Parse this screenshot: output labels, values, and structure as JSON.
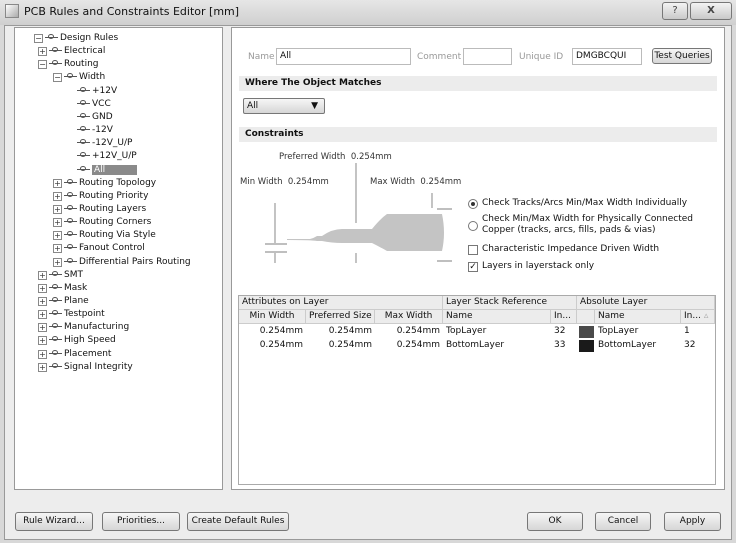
{
  "window": {
    "title": "PCB Rules and Constraints Editor [mm]",
    "help_label": "?",
    "close_label": "X"
  },
  "tree": {
    "items": [
      {
        "label": "Design Rules",
        "level": 0,
        "exp": "−"
      },
      {
        "label": "Electrical",
        "level": 1,
        "exp": "+"
      },
      {
        "label": "Routing",
        "level": 1,
        "exp": "−"
      },
      {
        "label": "Width",
        "level": 2,
        "exp": "−"
      },
      {
        "label": "+12V",
        "level": 3
      },
      {
        "label": "VCC",
        "level": 3
      },
      {
        "label": "GND",
        "level": 3
      },
      {
        "label": "-12V",
        "level": 3
      },
      {
        "label": "-12V_U/P",
        "level": 3
      },
      {
        "label": "+12V_U/P",
        "level": 3
      },
      {
        "label": "All",
        "level": 3,
        "selected": true
      },
      {
        "label": "Routing Topology",
        "level": 2,
        "exp": "+"
      },
      {
        "label": "Routing Priority",
        "level": 2,
        "exp": "+"
      },
      {
        "label": "Routing Layers",
        "level": 2,
        "exp": "+"
      },
      {
        "label": "Routing Corners",
        "level": 2,
        "exp": "+"
      },
      {
        "label": "Routing Via Style",
        "level": 2,
        "exp": "+"
      },
      {
        "label": "Fanout Control",
        "level": 2,
        "exp": "+"
      },
      {
        "label": "Differential Pairs Routing",
        "level": 2,
        "exp": "+"
      },
      {
        "label": "SMT",
        "level": 1,
        "exp": "+"
      },
      {
        "label": "Mask",
        "level": 1,
        "exp": "+"
      },
      {
        "label": "Plane",
        "level": 1,
        "exp": "+"
      },
      {
        "label": "Testpoint",
        "level": 1,
        "exp": "+"
      },
      {
        "label": "Manufacturing",
        "level": 1,
        "exp": "+"
      },
      {
        "label": "High Speed",
        "level": 1,
        "exp": "+"
      },
      {
        "label": "Placement",
        "level": 1,
        "exp": "+"
      },
      {
        "label": "Signal Integrity",
        "level": 1,
        "exp": "+"
      }
    ]
  },
  "rule": {
    "name_label": "Name",
    "name": "All",
    "comment_label": "Comment",
    "comment": "",
    "uid_label": "Unique ID",
    "uid": "DMGBCQUI",
    "test_queries": "Test Queries"
  },
  "match": {
    "header": "Where The Object Matches",
    "selected": "All"
  },
  "constraints": {
    "header": "Constraints",
    "preferred": "Preferred Width",
    "preferred_val": "0.254mm",
    "min": "Min Width",
    "min_val": "0.254mm",
    "max": "Max Width",
    "max_val": "0.254mm",
    "radio1": "Check Tracks/Arcs Min/Max Width Individually",
    "radio2a": "Check Min/Max Width for Physically Connected",
    "radio2b": "Copper (tracks, arcs, fills, pads & vias)",
    "cb1": "Characteristic Impedance Driven Width",
    "cb2": "Layers in layerstack only",
    "cb1_checked": false,
    "cb2_checked": true,
    "radio_selected": 1
  },
  "grid": {
    "groups": [
      "Attributes on Layer",
      "Layer Stack Reference",
      "Absolute Layer"
    ],
    "columns": [
      "Min Width",
      "Preferred Size",
      "Max Width",
      "Name",
      "In...",
      "",
      "Name",
      "In..."
    ],
    "rows": [
      {
        "min": "0.254mm",
        "pref": "0.254mm",
        "max": "0.254mm",
        "stack_name": "TopLayer",
        "stack_idx": "32",
        "color": "#4a4a4a",
        "abs_name": "TopLayer",
        "abs_idx": "1"
      },
      {
        "min": "0.254mm",
        "pref": "0.254mm",
        "max": "0.254mm",
        "stack_name": "BottomLayer",
        "stack_idx": "33",
        "color": "#1a1a1a",
        "abs_name": "BottomLayer",
        "abs_idx": "32"
      }
    ]
  },
  "buttons": {
    "wizard": "Rule Wizard...",
    "priorities": "Priorities...",
    "defaults": "Create Default Rules",
    "ok": "OK",
    "cancel": "Cancel",
    "apply": "Apply"
  }
}
